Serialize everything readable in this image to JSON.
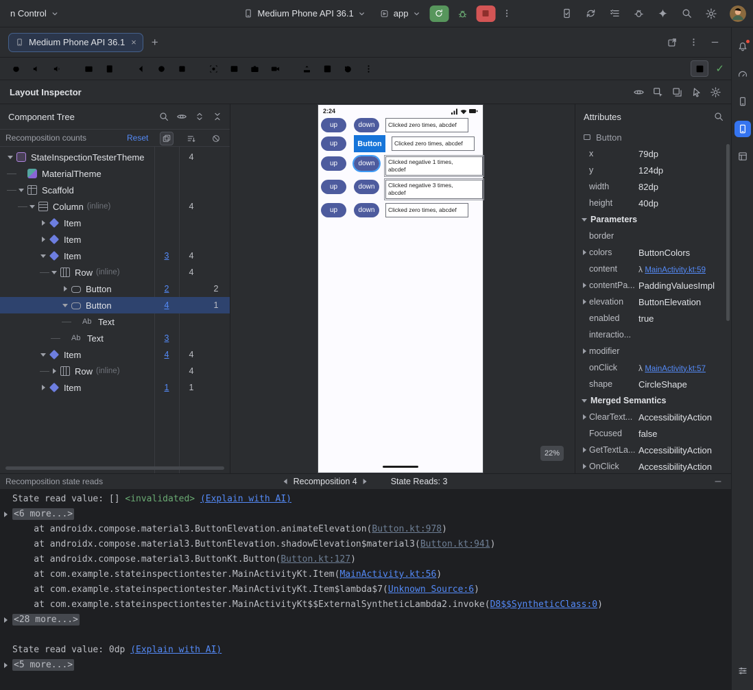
{
  "colors": {
    "accent": "#3574f0",
    "selection": "#2e436e",
    "link": "#548af7",
    "run_green": "#57965c",
    "stop_red": "#d35555",
    "device_button": "#4d5b9e",
    "selection_highlight": "#3f9bf5",
    "label_blue": "#1674d9"
  },
  "titlebar": {
    "vcs_label": "n Control",
    "device_selector": "Medium Phone API 36.1",
    "run_config": "app"
  },
  "tab_bar": {
    "active_tab": "Medium Phone API 36.1"
  },
  "inspector_bar": {
    "title": "Layout Inspector"
  },
  "component_tree": {
    "title": "Component Tree",
    "counts_label": "Recomposition counts",
    "reset_label": "Reset",
    "text_icon": "Ab",
    "nodes": [
      {
        "label": "StateInspectionTesterTheme",
        "depth": 0,
        "chev": "d",
        "icon": "theme",
        "c2": "4"
      },
      {
        "label": "MaterialTheme",
        "depth": 1,
        "chev": "",
        "icon": "material",
        "conn": true
      },
      {
        "label": "Scaffold",
        "depth": 1,
        "chev": "d",
        "icon": "scaffold",
        "conn": true
      },
      {
        "label": "Column",
        "note": "(inline)",
        "depth": 2,
        "chev": "d",
        "icon": "column",
        "conn": true,
        "c2": "4"
      },
      {
        "label": "Item",
        "depth": 3,
        "chev": "r",
        "icon": "item"
      },
      {
        "label": "Item",
        "depth": 3,
        "chev": "r",
        "icon": "item"
      },
      {
        "label": "Item",
        "depth": 3,
        "chev": "d",
        "icon": "item",
        "c1": "3",
        "c2": "4"
      },
      {
        "label": "Row",
        "note": "(inline)",
        "depth": 4,
        "chev": "d",
        "icon": "row",
        "conn": true,
        "c2": "4"
      },
      {
        "label": "Button",
        "depth": 5,
        "chev": "r",
        "icon": "button",
        "c1": "2",
        "c3": "2"
      },
      {
        "label": "Button",
        "depth": 5,
        "chev": "d",
        "icon": "button",
        "sel": true,
        "c1": "4",
        "c3": "1"
      },
      {
        "label": "Text",
        "depth": 6,
        "chev": "",
        "icon": "text",
        "conn": true
      },
      {
        "label": "Text",
        "depth": 5,
        "chev": "",
        "icon": "text",
        "conn": true,
        "c1": "3"
      },
      {
        "label": "Item",
        "depth": 3,
        "chev": "d",
        "icon": "item",
        "c1": "4",
        "c2": "4"
      },
      {
        "label": "Row",
        "note": "(inline)",
        "depth": 4,
        "chev": "r",
        "icon": "row",
        "conn": true,
        "c2": "4"
      },
      {
        "label": "Item",
        "depth": 3,
        "chev": "r",
        "icon": "item",
        "c1": "1",
        "c2": "1"
      }
    ]
  },
  "device": {
    "status_time": "2:24",
    "selection_label": "Button",
    "zoom_badge": "22%",
    "rows": [
      {
        "up": "up",
        "down": "down",
        "text": "Clicked zero times, abcdef"
      },
      {
        "up": "up",
        "label": "Button",
        "text": "Clicked zero times, abcdef"
      },
      {
        "up": "up",
        "down": "down",
        "text": "Clicked negative 1 times, abcdef",
        "selected": true,
        "twoline": true,
        "boxed": true
      },
      {
        "up": "up",
        "down": "down",
        "text": "Clicked negative 3 times, abcdef",
        "twoline": true,
        "boxed": true
      },
      {
        "up": "up",
        "down": "down",
        "text": "Clicked zero times, abcdef"
      }
    ]
  },
  "attributes": {
    "title": "Attributes",
    "component": "Button",
    "rows": [
      {
        "key": "x",
        "value": "79dp"
      },
      {
        "key": "y",
        "value": "124dp"
      },
      {
        "key": "width",
        "value": "82dp"
      },
      {
        "key": "height",
        "value": "40dp"
      },
      {
        "section": "Parameters"
      },
      {
        "key": "border",
        "value": ""
      },
      {
        "key": "colors",
        "value": "ButtonColors",
        "expand": true
      },
      {
        "key": "content",
        "link": "MainActivity.kt:59",
        "lambda": true
      },
      {
        "key": "contentPa...",
        "value": "PaddingValuesImpl",
        "expand": true
      },
      {
        "key": "elevation",
        "value": "ButtonElevation",
        "expand": true
      },
      {
        "key": "enabled",
        "value": "true"
      },
      {
        "key": "interactio...",
        "value": ""
      },
      {
        "key": "modifier",
        "value": "",
        "expand": true
      },
      {
        "key": "onClick",
        "link": "MainActivity.kt:57",
        "lambda": true
      },
      {
        "key": "shape",
        "value": "CircleShape"
      },
      {
        "section": "Merged Semantics"
      },
      {
        "key": "ClearText...",
        "value": "AccessibilityAction",
        "expand": true
      },
      {
        "key": "Focused",
        "value": "false"
      },
      {
        "key": "GetTextLa...",
        "value": "AccessibilityAction",
        "expand": true
      },
      {
        "key": "OnClick",
        "value": "AccessibilityAction",
        "expand": true
      }
    ]
  },
  "console": {
    "title": "Recomposition state reads",
    "nav_label": "Recomposition 4",
    "state_reads": "State Reads: 3",
    "lines": [
      {
        "segs": [
          {
            "t": "State read value: [] ",
            "s": "plain"
          },
          {
            "t": "<invalidated>",
            "s": "green"
          },
          {
            "t": " ",
            "s": "plain"
          },
          {
            "t": "(Explain with AI)",
            "s": "link"
          }
        ]
      },
      {
        "fold": true,
        "text": "<6 more...>"
      },
      {
        "segs": [
          {
            "t": "    at androidx.compose.material3.ButtonElevation.animateElevation(",
            "s": "plain"
          },
          {
            "t": "Button.kt:978",
            "s": "dimlink"
          },
          {
            "t": ")",
            "s": "plain"
          }
        ]
      },
      {
        "segs": [
          {
            "t": "    at androidx.compose.material3.ButtonElevation.shadowElevation$material3(",
            "s": "plain"
          },
          {
            "t": "Button.kt:941",
            "s": "dimlink"
          },
          {
            "t": ")",
            "s": "plain"
          }
        ]
      },
      {
        "segs": [
          {
            "t": "    at androidx.compose.material3.ButtonKt.Button(",
            "s": "plain"
          },
          {
            "t": "Button.kt:127",
            "s": "dimlink"
          },
          {
            "t": ")",
            "s": "plain"
          }
        ]
      },
      {
        "segs": [
          {
            "t": "    at com.example.stateinspectiontester.MainActivityKt.Item(",
            "s": "plain"
          },
          {
            "t": "MainActivity.kt:56",
            "s": "link"
          },
          {
            "t": ")",
            "s": "plain"
          }
        ]
      },
      {
        "segs": [
          {
            "t": "    at com.example.stateinspectiontester.MainActivityKt.Item$lambda$7(",
            "s": "plain"
          },
          {
            "t": "Unknown Source:6",
            "s": "link"
          },
          {
            "t": ")",
            "s": "plain"
          }
        ]
      },
      {
        "segs": [
          {
            "t": "    at com.example.stateinspectiontester.MainActivityKt$$ExternalSyntheticLambda2.invoke(",
            "s": "plain"
          },
          {
            "t": "D8$$SyntheticClass:0",
            "s": "link"
          },
          {
            "t": ")",
            "s": "plain"
          }
        ]
      },
      {
        "fold": true,
        "text": "<28 more...>"
      },
      {
        "blank": true
      },
      {
        "segs": [
          {
            "t": "State read value: 0dp ",
            "s": "plain"
          },
          {
            "t": "(Explain with AI)",
            "s": "link"
          }
        ]
      },
      {
        "fold": true,
        "text": "<5 more...>"
      }
    ]
  }
}
